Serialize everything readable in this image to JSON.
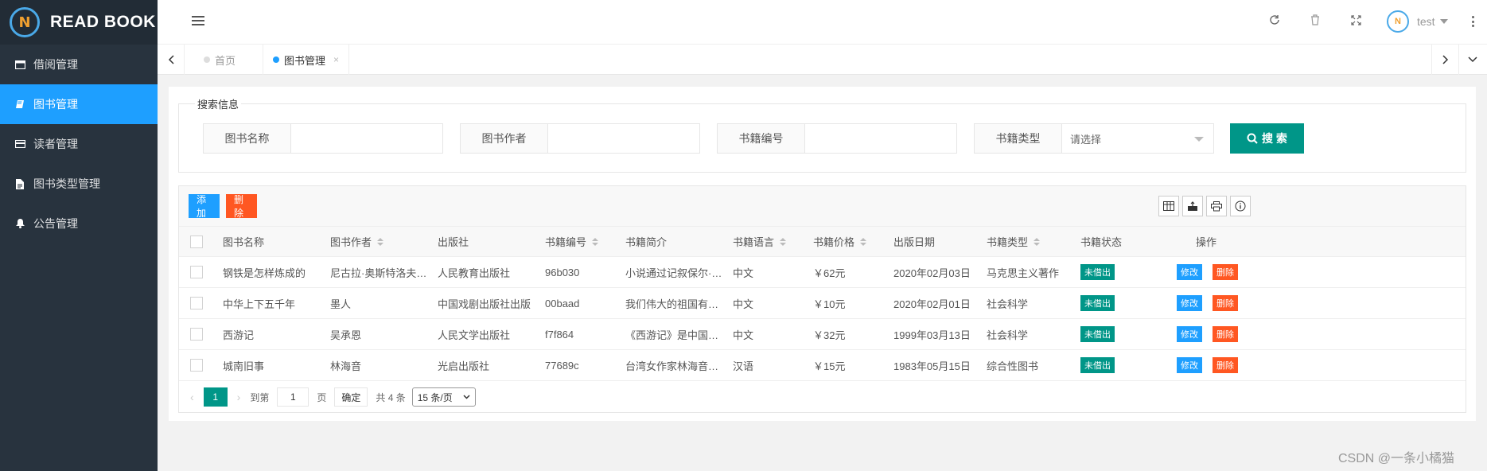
{
  "app": {
    "logo_text": "READ BOOK",
    "logo_mark": "N"
  },
  "sidebar": {
    "items": [
      {
        "label": "借阅管理",
        "icon": "window-icon"
      },
      {
        "label": "图书管理",
        "icon": "book-icon",
        "active": true
      },
      {
        "label": "读者管理",
        "icon": "card-icon"
      },
      {
        "label": "图书类型管理",
        "icon": "file-icon"
      },
      {
        "label": "公告管理",
        "icon": "bell-icon"
      }
    ]
  },
  "header": {
    "user_name": "test"
  },
  "tabs": [
    {
      "label": "首页"
    },
    {
      "label": "图书管理",
      "active": true,
      "close": "×"
    }
  ],
  "search": {
    "legend": "搜索信息",
    "fields": [
      {
        "label": "图书名称",
        "value": ""
      },
      {
        "label": "图书作者",
        "value": ""
      },
      {
        "label": "书籍编号",
        "value": ""
      },
      {
        "label": "书籍类型",
        "placeholder": "请选择"
      }
    ],
    "button": "搜 索"
  },
  "toolbar": {
    "add": "添加",
    "delete": "删除"
  },
  "table": {
    "columns": [
      "图书名称",
      "图书作者",
      "出版社",
      "书籍编号",
      "书籍简介",
      "书籍语言",
      "书籍价格",
      "出版日期",
      "书籍类型",
      "书籍状态",
      "操作"
    ],
    "rows": [
      {
        "name": "钢铁是怎样炼成的",
        "author": "尼古拉·奥斯特洛夫…",
        "publisher": "人民教育出版社",
        "code": "96b030",
        "intro": "小说通过记叙保尔·…",
        "lang": "中文",
        "price": "￥62元",
        "date": "2020年02月03日",
        "type": "马克思主义著作",
        "status": "未借出"
      },
      {
        "name": "中华上下五千年",
        "author": "墨人",
        "publisher": "中国戏剧出版社出版",
        "code": "00baad",
        "intro": "我们伟大的祖国有…",
        "lang": "中文",
        "price": "￥10元",
        "date": "2020年02月01日",
        "type": "社会科学",
        "status": "未借出"
      },
      {
        "name": "西游记",
        "author": "吴承恩",
        "publisher": "人民文学出版社",
        "code": "f7f864",
        "intro": "《西游记》是中国…",
        "lang": "中文",
        "price": "￥32元",
        "date": "1999年03月13日",
        "type": "社会科学",
        "status": "未借出"
      },
      {
        "name": "城南旧事",
        "author": "林海音",
        "publisher": "光启出版社",
        "code": "77689c",
        "intro": "台湾女作家林海音…",
        "lang": "汉语",
        "price": "￥15元",
        "date": "1983年05月15日",
        "type": "综合性图书",
        "status": "未借出"
      }
    ],
    "edit_label": "修改",
    "delete_label": "删除"
  },
  "pager": {
    "current": "1",
    "goto_prefix": "到第",
    "goto_value": "1",
    "goto_suffix": "页",
    "confirm": "确定",
    "total": "共 4 条",
    "per_page": "15 条/页"
  },
  "watermark": "CSDN @一条小橘猫",
  "colors": {
    "sidebar": "#28333e",
    "accent_blue": "#1e9fff",
    "teal": "#009688",
    "orange": "#ff5722"
  }
}
